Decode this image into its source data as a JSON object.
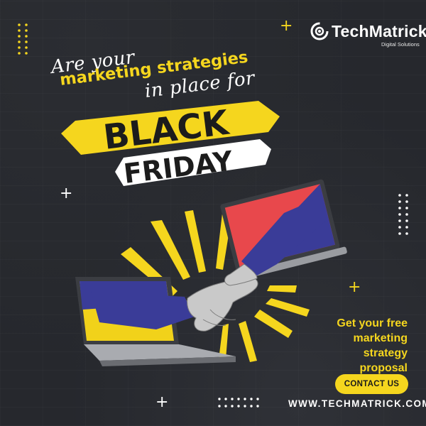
{
  "brand": {
    "name": "TechMatrick",
    "tagline": "Digital Solutions",
    "accent_color": "#f5d61e",
    "background_color": "#26282d"
  },
  "headline": {
    "line1": "Are your",
    "line2": "marketing strategies",
    "line3": "in place for"
  },
  "banner": {
    "word1": "BLACK",
    "word2": "FRIDAY"
  },
  "cta": {
    "line1": "Get your free",
    "line2": "marketing",
    "line3": "strategy",
    "line4": "proposal",
    "button_label": "CONTACT US"
  },
  "website": "WWW.TECHMATRICK.COM/",
  "illustration": {
    "subject": "handshake-between-laptops",
    "laptop_left_screen_colors": [
      "#f1d21a",
      "#3a3c98"
    ],
    "laptop_right_screen_colors": [
      "#e8484c",
      "#3a3c98"
    ]
  },
  "decorations": [
    "plus-icon",
    "dot-grid",
    "sunburst-rays"
  ]
}
